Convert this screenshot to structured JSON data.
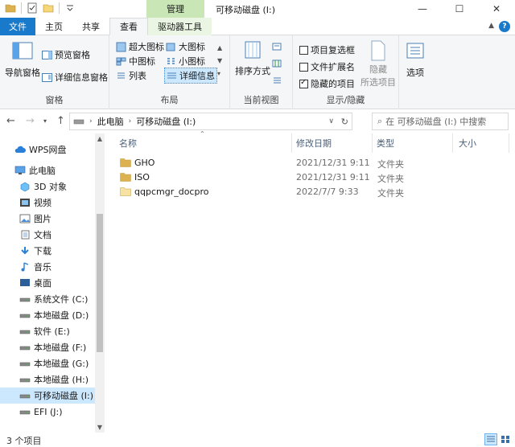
{
  "window": {
    "title": "可移动磁盘 (I:)",
    "manage_tab": "管理",
    "minimize": "—",
    "maximize": "☐",
    "close": "✕"
  },
  "tabs": [
    {
      "label": "文件"
    },
    {
      "label": "主页"
    },
    {
      "label": "共享"
    },
    {
      "label": "查看"
    },
    {
      "label": "驱动器工具"
    }
  ],
  "ribbon": {
    "pane": {
      "nav_pane": "导航窗格",
      "preview_pane": "预览窗格",
      "details_pane": "详细信息窗格",
      "group_label": "窗格"
    },
    "layout": {
      "extra_large": "超大图标",
      "large": "大图标",
      "medium": "中图标",
      "small": "小图标",
      "list": "列表",
      "details": "详细信息",
      "group_label": "布局"
    },
    "current_view": {
      "sort_by": "排序方式",
      "group_label": "当前视图"
    },
    "show_hide": {
      "item_checkboxes": "项目复选框",
      "file_extensions": "文件扩展名",
      "hidden_items": "隐藏的项目",
      "hide_selected_line1": "隐藏",
      "hide_selected_line2": "所选项目",
      "group_label": "显示/隐藏",
      "item_checkboxes_checked": false,
      "file_extensions_checked": false,
      "hidden_items_checked": true
    },
    "options": {
      "label": "选项"
    }
  },
  "address": {
    "segments": [
      "此电脑",
      "可移动磁盘 (I:)"
    ],
    "search_placeholder": "在 可移动磁盘 (I:) 中搜索"
  },
  "nav": {
    "items": [
      {
        "label": "WPS网盘",
        "icon": "cloud-icon"
      },
      {
        "label": "此电脑",
        "icon": "computer-icon"
      },
      {
        "label": "3D 对象",
        "icon": "3d-objects-icon"
      },
      {
        "label": "视频",
        "icon": "video-icon"
      },
      {
        "label": "图片",
        "icon": "pictures-icon"
      },
      {
        "label": "文档",
        "icon": "documents-icon"
      },
      {
        "label": "下载",
        "icon": "download-icon"
      },
      {
        "label": "音乐",
        "icon": "music-icon"
      },
      {
        "label": "桌面",
        "icon": "desktop-icon"
      },
      {
        "label": "系统文件 (C:)",
        "icon": "drive-icon"
      },
      {
        "label": "本地磁盘 (D:)",
        "icon": "drive-icon"
      },
      {
        "label": "软件 (E:)",
        "icon": "drive-icon"
      },
      {
        "label": "本地磁盘 (F:)",
        "icon": "drive-icon"
      },
      {
        "label": "本地磁盘 (G:)",
        "icon": "drive-icon"
      },
      {
        "label": "本地磁盘 (H:)",
        "icon": "drive-icon"
      },
      {
        "label": "可移动磁盘 (I:)",
        "icon": "drive-icon"
      },
      {
        "label": "EFI (J:)",
        "icon": "drive-icon"
      }
    ]
  },
  "columns": {
    "name": "名称",
    "date": "修改日期",
    "type": "类型",
    "size": "大小"
  },
  "files": [
    {
      "name": "GHO",
      "date": "2021/12/31 9:11",
      "type": "文件夹"
    },
    {
      "name": "ISO",
      "date": "2021/12/31 9:11",
      "type": "文件夹"
    },
    {
      "name": "qqpcmgr_docpro",
      "date": "2022/7/7 9:33",
      "type": "文件夹"
    }
  ],
  "status": {
    "count": "3 个项目"
  },
  "colors": {
    "file_tab": "#1979ca",
    "manage_tab": "#c8e6b6",
    "selection": "#cce8ff",
    "folder": "#dcb14f"
  }
}
